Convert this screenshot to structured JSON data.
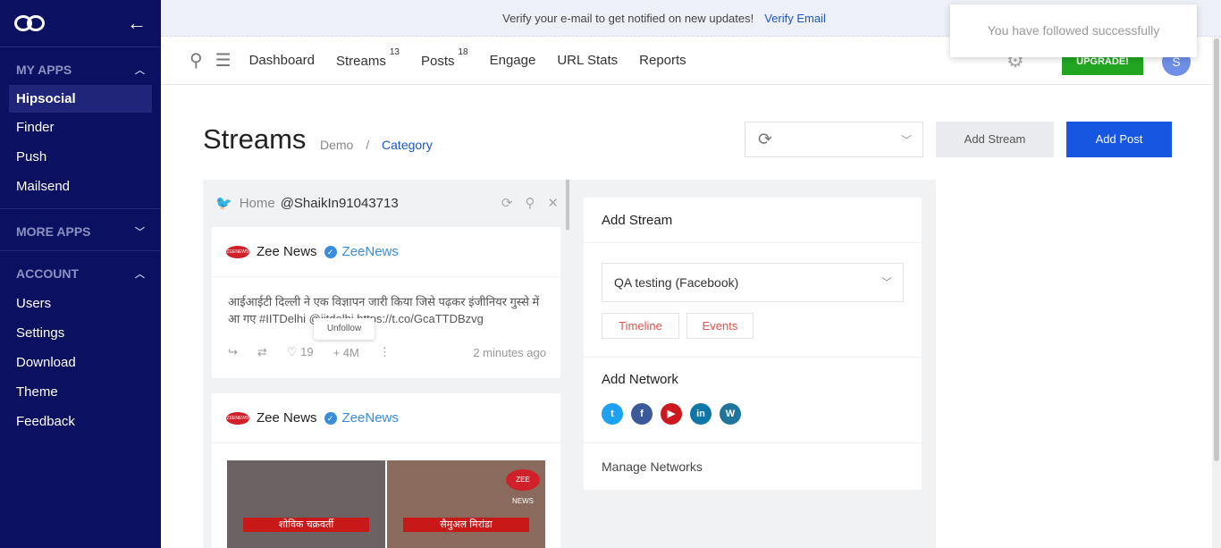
{
  "sidebar": {
    "my_apps_label": "MY APPS",
    "my_apps": [
      "Hipsocial",
      "Finder",
      "Push",
      "Mailsend"
    ],
    "more_apps_label": "MORE APPS",
    "account_label": "ACCOUNT",
    "account": [
      "Users",
      "Settings",
      "Download",
      "Theme",
      "Feedback"
    ]
  },
  "verify": {
    "text": "Verify your e-mail to get notified on new updates!",
    "link": "Verify Email"
  },
  "nav": {
    "dashboard": "Dashboard",
    "streams": "Streams",
    "streams_count": "13",
    "posts": "Posts",
    "posts_count": "18",
    "engage": "Engage",
    "url_stats": "URL Stats",
    "reports": "Reports",
    "upgrade": "UPGRADE!",
    "avatar": "S"
  },
  "toast": {
    "text": "You have followed successfully"
  },
  "page": {
    "title": "Streams",
    "crumb_root": "Demo",
    "crumb_sep": "/",
    "crumb_current": "Category",
    "add_stream_btn": "Add Stream",
    "add_post_btn": "Add Post"
  },
  "stream": {
    "home": "Home",
    "handle": "@ShaikIn91043713",
    "posts": [
      {
        "name": "Zee News",
        "handle": "ZeeNews",
        "logo": "ZEENEWS",
        "text": "आईआईटी दिल्ली ने एक विज्ञापन जारी किया जिसे पढ़कर इंजीनियर गुस्से में आ गए #IITDelhi @iitdelhi https://t.co/GcaTTDBzvg",
        "likes": "19",
        "followers": "4M",
        "time": "2 minutes ago",
        "tooltip": "Unfollow"
      },
      {
        "name": "Zee News",
        "handle": "ZeeNews",
        "logo": "ZEENEWS",
        "caption_left": "शोविक चक्रवर्ती",
        "caption_right": "सैमुअल मिरांडा",
        "image_logo": "ZEE NEWS"
      }
    ]
  },
  "add_stream": {
    "title": "Add Stream",
    "account": "QA testing (Facebook)",
    "timeline": "Timeline",
    "events": "Events",
    "network_title": "Add Network",
    "networks": [
      {
        "name": "twitter-icon",
        "glyph": "t",
        "color": "#1da1f2"
      },
      {
        "name": "facebook-icon",
        "glyph": "f",
        "color": "#3b5998"
      },
      {
        "name": "youtube-icon",
        "glyph": "▶",
        "color": "#cc181e"
      },
      {
        "name": "linkedin-icon",
        "glyph": "in",
        "color": "#0e76a8"
      },
      {
        "name": "wordpress-icon",
        "glyph": "W",
        "color": "#21759b"
      }
    ],
    "manage": "Manage Networks"
  }
}
